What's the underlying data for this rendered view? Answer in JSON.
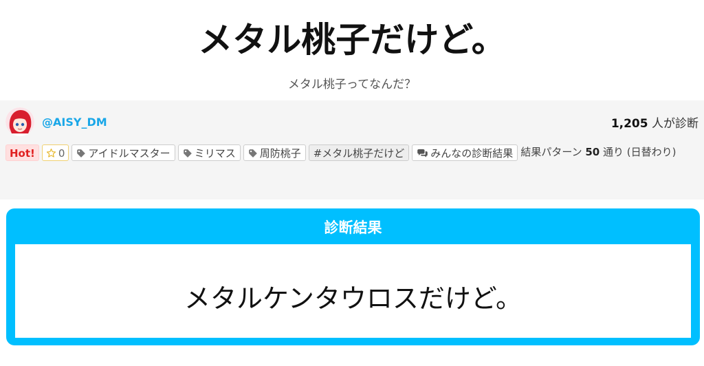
{
  "title": "メタル桃子だけど。",
  "subtitle": "メタル桃子ってなんだ？",
  "author": {
    "name": "@AISY_DM",
    "avatar_icon": "avatar-red-hair-character"
  },
  "stats": {
    "count": "1,205",
    "count_suffix": " 人が診断"
  },
  "badges": {
    "hot": "Hot!",
    "favorite_count": "0"
  },
  "tags": [
    "アイドルマスター",
    "ミリマス",
    "周防桃子"
  ],
  "hashtag": "#メタル桃子だけど",
  "results_link": "みんなの診断結果",
  "pattern": {
    "prefix": "結果パターン ",
    "count": "50",
    "suffix": " 通り (日替わり)"
  },
  "result": {
    "header": "診断結果",
    "text": "メタルケンタウロスだけど。"
  },
  "colors": {
    "accent": "#00bfff",
    "author_link": "#1aa7e8",
    "hot": "#e02020",
    "panel_bg": "#f5f5f5"
  }
}
